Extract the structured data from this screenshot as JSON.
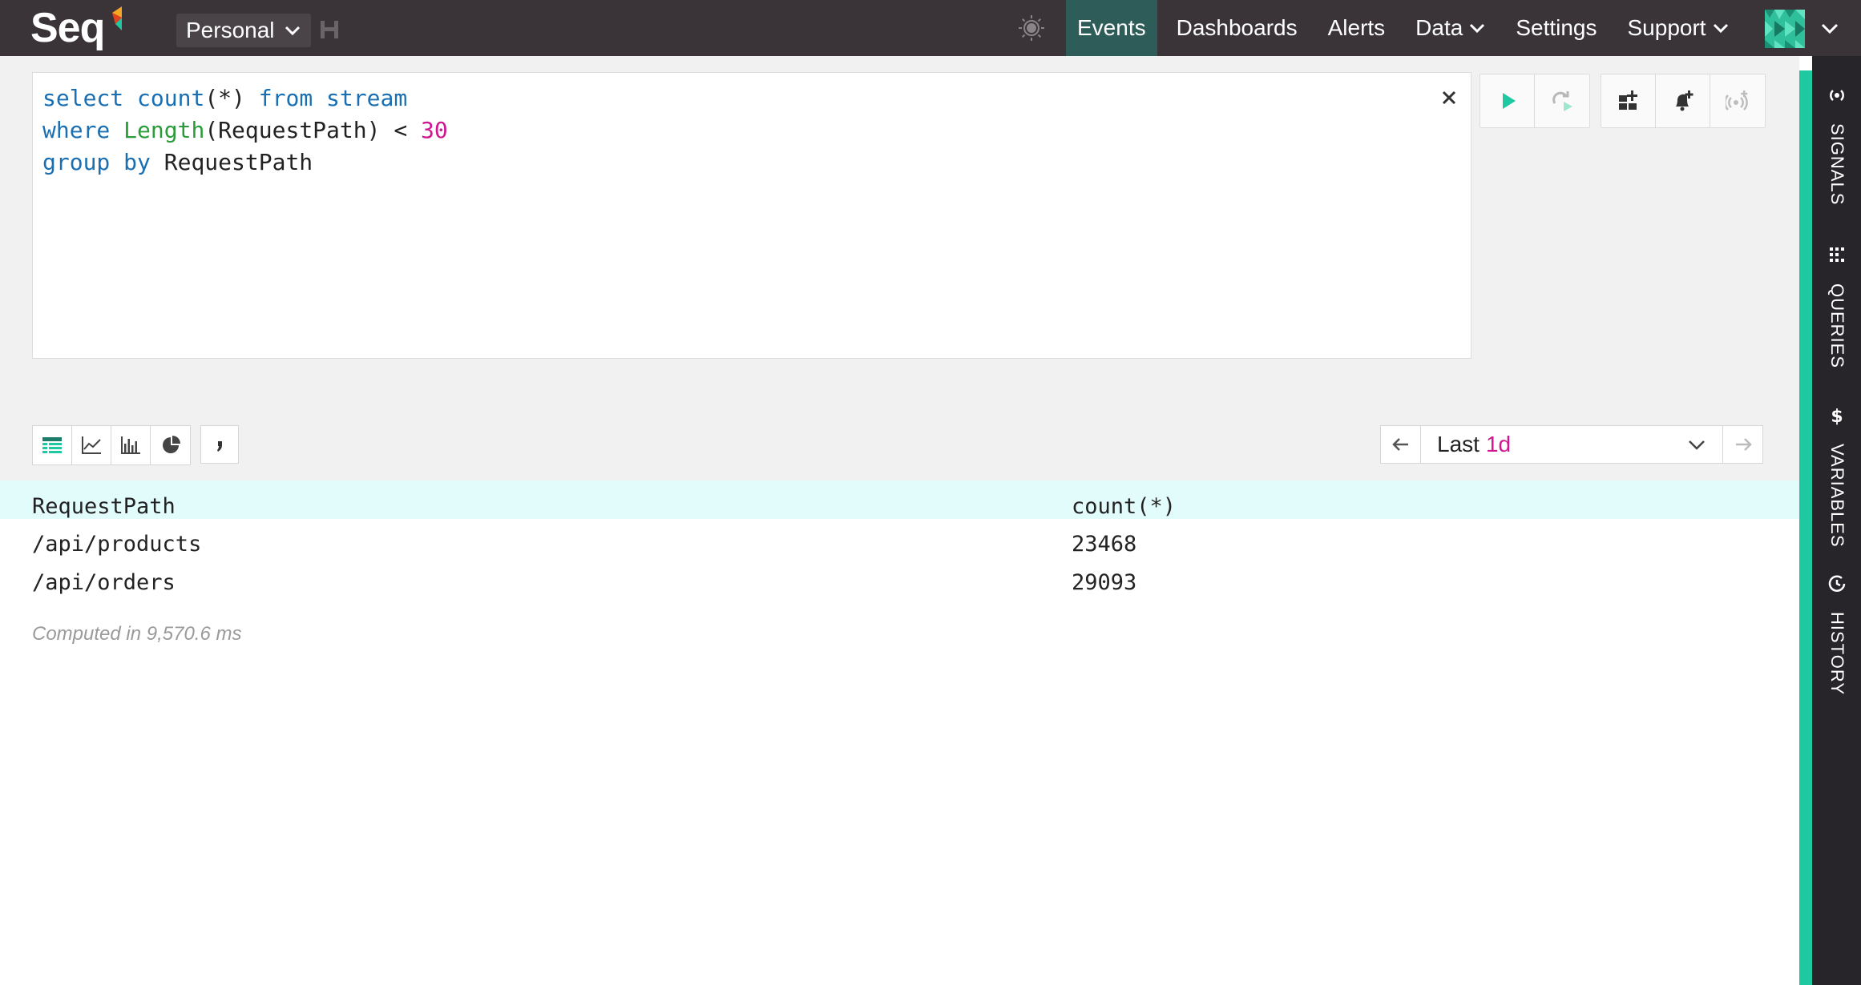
{
  "app": {
    "logo_text": "Seq",
    "workspace": "Personal"
  },
  "nav": {
    "items": [
      {
        "label": "Events",
        "active": true,
        "dropdown": false
      },
      {
        "label": "Dashboards",
        "active": false,
        "dropdown": false
      },
      {
        "label": "Alerts",
        "active": false,
        "dropdown": false
      },
      {
        "label": "Data",
        "active": false,
        "dropdown": true
      },
      {
        "label": "Settings",
        "active": false,
        "dropdown": false
      },
      {
        "label": "Support",
        "active": false,
        "dropdown": true
      }
    ]
  },
  "rail": {
    "items": [
      {
        "label": "SIGNALS",
        "icon": "signals-icon"
      },
      {
        "label": "QUERIES",
        "icon": "queries-icon"
      },
      {
        "label": "VARIABLES",
        "icon": "dollar-icon"
      },
      {
        "label": "HISTORY",
        "icon": "history-icon"
      }
    ]
  },
  "query": {
    "lines": [
      {
        "tokens": [
          [
            "kw",
            "select"
          ],
          [
            "p",
            " "
          ],
          [
            "kw",
            "count"
          ],
          [
            "p",
            "(*)"
          ],
          [
            "p",
            " "
          ],
          [
            "kw",
            "from"
          ],
          [
            "p",
            " "
          ],
          [
            "kw",
            "stream"
          ]
        ]
      },
      {
        "tokens": [
          [
            "kw",
            "where"
          ],
          [
            "p",
            " "
          ],
          [
            "fn",
            "Length"
          ],
          [
            "p",
            "(RequestPath) < "
          ],
          [
            "num",
            "30"
          ]
        ]
      },
      {
        "tokens": [
          [
            "kw",
            "group"
          ],
          [
            "p",
            " "
          ],
          [
            "kw",
            "by"
          ],
          [
            "p",
            " RequestPath"
          ]
        ]
      }
    ]
  },
  "time_range": {
    "prefix": "Last",
    "value": "1d"
  },
  "results": {
    "columns": [
      "RequestPath",
      "count(*)"
    ],
    "rows": [
      [
        "/api/products",
        "23468"
      ],
      [
        "/api/orders",
        "29093"
      ]
    ],
    "computed": "Computed in 9,570.6 ms"
  },
  "colors": {
    "topbar": "#3a3438",
    "accent": "#1ec8a0",
    "active_nav": "#2e5c59",
    "keyword": "#1a6fb3",
    "function": "#2a9d3a",
    "number": "#d01690",
    "run": "#1ec8a0"
  }
}
